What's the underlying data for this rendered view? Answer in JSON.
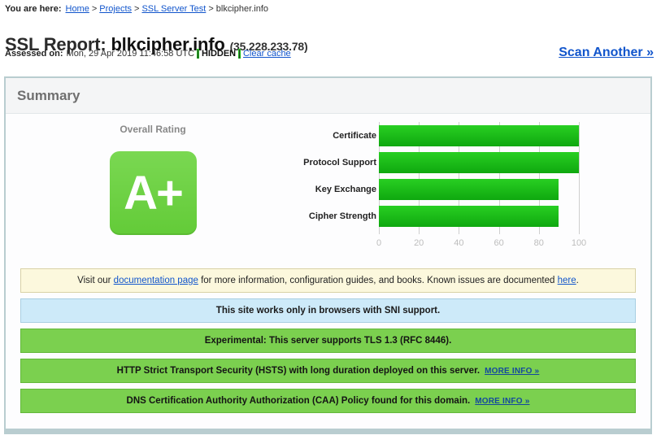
{
  "breadcrumb": {
    "lead": "You are here:",
    "items": [
      {
        "label": "Home",
        "link": true
      },
      {
        "label": "Projects",
        "link": true
      },
      {
        "label": "SSL Server Test",
        "link": true
      },
      {
        "label": "blkcipher.info",
        "link": false
      }
    ],
    "separator": ">"
  },
  "header": {
    "title_prefix": "SSL Report:",
    "domain": "blkcipher.info",
    "ip": "(35.228.233.78)",
    "assessed_label": "Assessed on:",
    "assessed_value": "Mon, 29 Apr 2019 11:46:58 UTC",
    "separator": "|",
    "hidden_label": "HIDDEN",
    "clear_cache_label": "Clear cache",
    "scan_another_label": "Scan Another »"
  },
  "summary": {
    "panel_title": "Summary",
    "rating_label": "Overall Rating",
    "grade": "A+"
  },
  "chart_data": {
    "type": "bar",
    "orientation": "horizontal",
    "title": "",
    "categories": [
      "Certificate",
      "Protocol Support",
      "Key Exchange",
      "Cipher Strength"
    ],
    "values": [
      100,
      100,
      90,
      90
    ],
    "xlabel": "",
    "ylabel": "",
    "xlim": [
      0,
      100
    ],
    "xticks": [
      0,
      20,
      40,
      60,
      80,
      100
    ],
    "xtick_labels": [
      "0",
      "20",
      "40",
      "60",
      "80",
      "100"
    ],
    "grid": true,
    "legend": false,
    "bar_color": "#1cbb1c"
  },
  "notices": [
    {
      "style": "yellow",
      "segments": [
        {
          "text": "Visit our ",
          "link": false
        },
        {
          "text": "documentation page",
          "link": true
        },
        {
          "text": " for more information, configuration guides, and books. Known issues are documented ",
          "link": false
        },
        {
          "text": "here",
          "link": true
        },
        {
          "text": ".",
          "link": false
        }
      ],
      "text": "Visit our documentation page for more information, configuration guides, and books. Known issues are documented here.",
      "more_info": null
    },
    {
      "style": "blue",
      "text": "This site works only in browsers with SNI support.",
      "more_info": null
    },
    {
      "style": "green",
      "text": "Experimental: This server supports TLS 1.3 (RFC 8446).",
      "more_info": null
    },
    {
      "style": "green",
      "text": "HTTP Strict Transport Security (HSTS) with long duration deployed on this server.",
      "more_info": "MORE INFO »"
    },
    {
      "style": "green",
      "text": "DNS Certification Authority Authorization (CAA) Policy found for this domain.",
      "more_info": "MORE INFO »"
    }
  ],
  "colors": {
    "link": "#1155cc",
    "grade_green": "#6bd140",
    "bar_green": "#1cbb1c",
    "notice_green": "#7bd04f",
    "notice_blue": "#cdeaf9",
    "notice_yellow": "#fcf8dd",
    "panel_border": "#b9cdd0"
  }
}
